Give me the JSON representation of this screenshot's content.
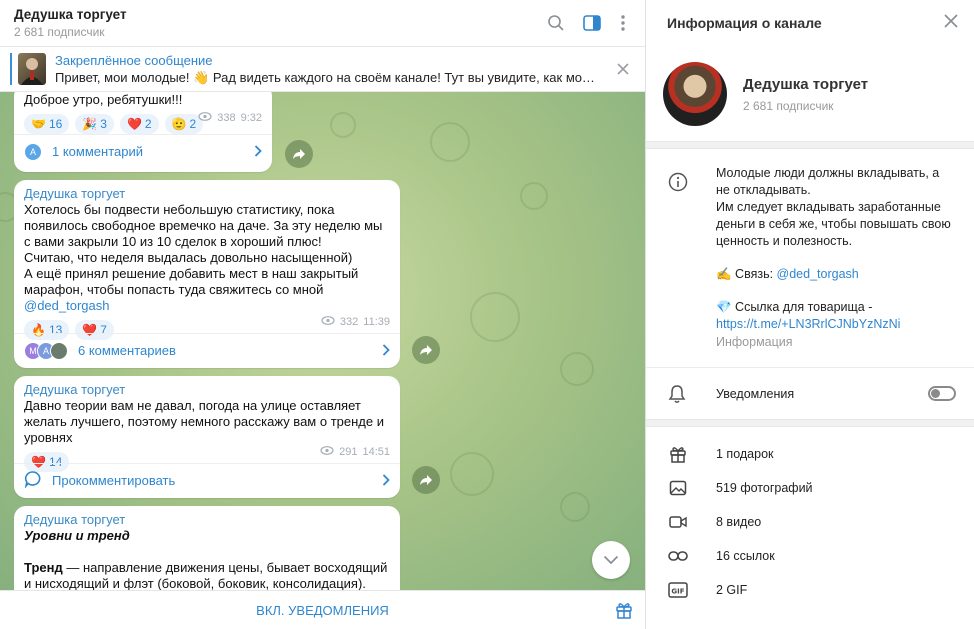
{
  "chat": {
    "title": "Дедушка торгует",
    "subscribers": "2 681 подписчик"
  },
  "pinned": {
    "title": "Закреплённое сообщение",
    "text": "Привет, мои молодые! 👋 Рад видеть каждого на своём канале!  Тут вы увидите, как можно за..."
  },
  "messages": [
    {
      "text": "Доброе утро, ребятушки!!!",
      "reactions": [
        {
          "emoji": "🤝",
          "count": "16"
        },
        {
          "emoji": "🎉",
          "count": "3"
        },
        {
          "emoji": "❤️",
          "count": "2"
        },
        {
          "emoji": "🫡",
          "count": "2"
        }
      ],
      "views": "338",
      "time": "9:32",
      "comment_avatar": "A",
      "comments": "1 комментарий"
    },
    {
      "author": "Дедушка торгует",
      "text": "Хотелось бы подвести небольшую статистику, пока появилось свободное времечко на даче. За эту неделю мы с вами закрыли 10 из 10 сделок в хороший плюс!\nСчитаю, что неделя выдалась довольно насыщенной)\nА ещё принял решение добавить мест в наш закрытый марафон, чтобы попасть туда свяжитесь со мной ",
      "mention": "@ded_torgash",
      "reactions": [
        {
          "emoji": "🔥",
          "count": "13"
        },
        {
          "emoji": "❤️",
          "count": "7"
        }
      ],
      "views": "332",
      "time": "11:39",
      "comment_avatars": [
        "M",
        "A"
      ],
      "comments": "6 комментариев"
    },
    {
      "author": "Дедушка торгует",
      "text": "Давно теории вам не давал, погода на улице оставляет желать лучшего, поэтому немного расскажу вам о тренде и уровнях",
      "reactions": [
        {
          "emoji": "❤️",
          "count": "14"
        }
      ],
      "views": "291",
      "time": "14:51",
      "comments": "Прокомментировать"
    },
    {
      "author": "Дедушка торгует",
      "heading": "Уровни и тренд",
      "term": "Тренд",
      "text": " — направление движения цены, бывает восходящий и нисходящий и флэт (боковой, боковик, консолидация). Для"
    }
  ],
  "footer": {
    "notify_label": "ВКЛ. УВЕДОМЛЕНИЯ"
  },
  "info": {
    "header": "Информация о канале",
    "name": "Дедушка торгует",
    "subscribers": "2 681 подписчик",
    "about_lines": [
      "Молодые люди должны вкладывать, а не откладывать.",
      "Им следует вкладывать заработанные деньги в себя же, чтобы повышать свою ценность и полезность."
    ],
    "contact_prefix": "✍️ Связь: ",
    "contact_link": "@ded_torgash",
    "link_prefix": "💎 Ссылка для товарища -",
    "invite_link": "https://t.me/+LN3RrlCJNbYzNzNi",
    "about_caption": "Информация",
    "notifications_label": "Уведомления",
    "notifications_on": false,
    "media": [
      {
        "icon": "gift-icon",
        "label": "1 подарок"
      },
      {
        "icon": "photo-icon",
        "label": "519 фотографий"
      },
      {
        "icon": "video-icon",
        "label": "8 видео"
      },
      {
        "icon": "link-icon",
        "label": "16 ссылок"
      },
      {
        "icon": "gif-icon",
        "label": "2 GIF"
      }
    ]
  },
  "colors": {
    "accent": "#2f86cf",
    "author": "#3a8ac6",
    "reaction_bg": "#eaf3fc",
    "chat_bg": "#a9c588"
  }
}
